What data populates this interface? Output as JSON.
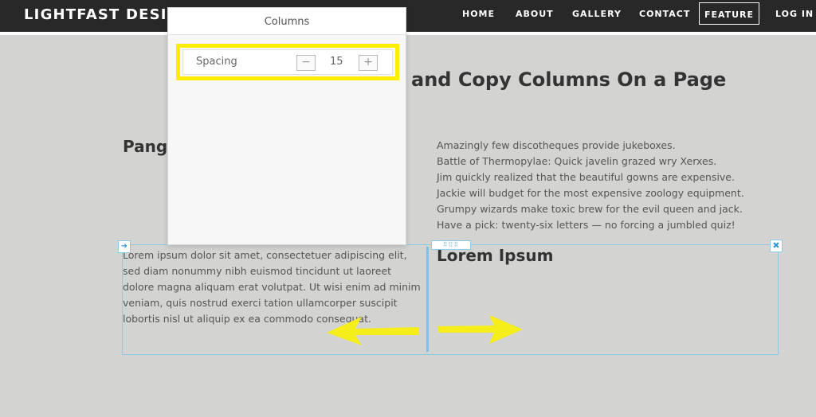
{
  "nav": {
    "brand": "LIGHTFAST DESIGN",
    "items": [
      "HOME",
      "ABOUT",
      "GALLERY",
      "CONTACT",
      "FEATURE",
      "LOG IN"
    ]
  },
  "page": {
    "title_visible": "and Copy Columns On a Page",
    "left_heading_visible": "Pangr",
    "pangrams": [
      "Amazingly few discotheques provide jukeboxes.",
      "Battle of Thermopylae: Quick javelin grazed wry Xerxes.",
      "Jim quickly realized that the beautiful gowns are expensive.",
      "Jackie will budget for the most expensive zoology equipment.",
      "Grumpy wizards make toxic brew for the evil queen and jack.",
      "Have a pick: twenty-six letters — no forcing a jumbled quiz!"
    ],
    "lorem_paragraph": "Lorem ipsum dolor sit amet, consectetuer adipiscing elit, sed diam nonummy nibh euismod tincidunt ut laoreet dolore magna aliquam erat volutpat. Ut wisi enim ad minim veniam, quis nostrud exerci tation ullamcorper suscipit lobortis nisl ut aliquip ex ea commodo consequat.",
    "lorem_heading": "Lorem Ipsum"
  },
  "panel": {
    "title": "Columns",
    "spacing_label": "Spacing",
    "spacing_value": "15",
    "minus": "−",
    "plus": "+"
  },
  "controls": {
    "corner_left_icon": "➜",
    "corner_right_icon": "✖",
    "drag_handle_icon": "⠿⠿⠿"
  },
  "colors": {
    "highlight": "#ffee00",
    "selection": "#8ec9e8",
    "arrow": "#f5ee1a",
    "navbar": "#282828"
  }
}
